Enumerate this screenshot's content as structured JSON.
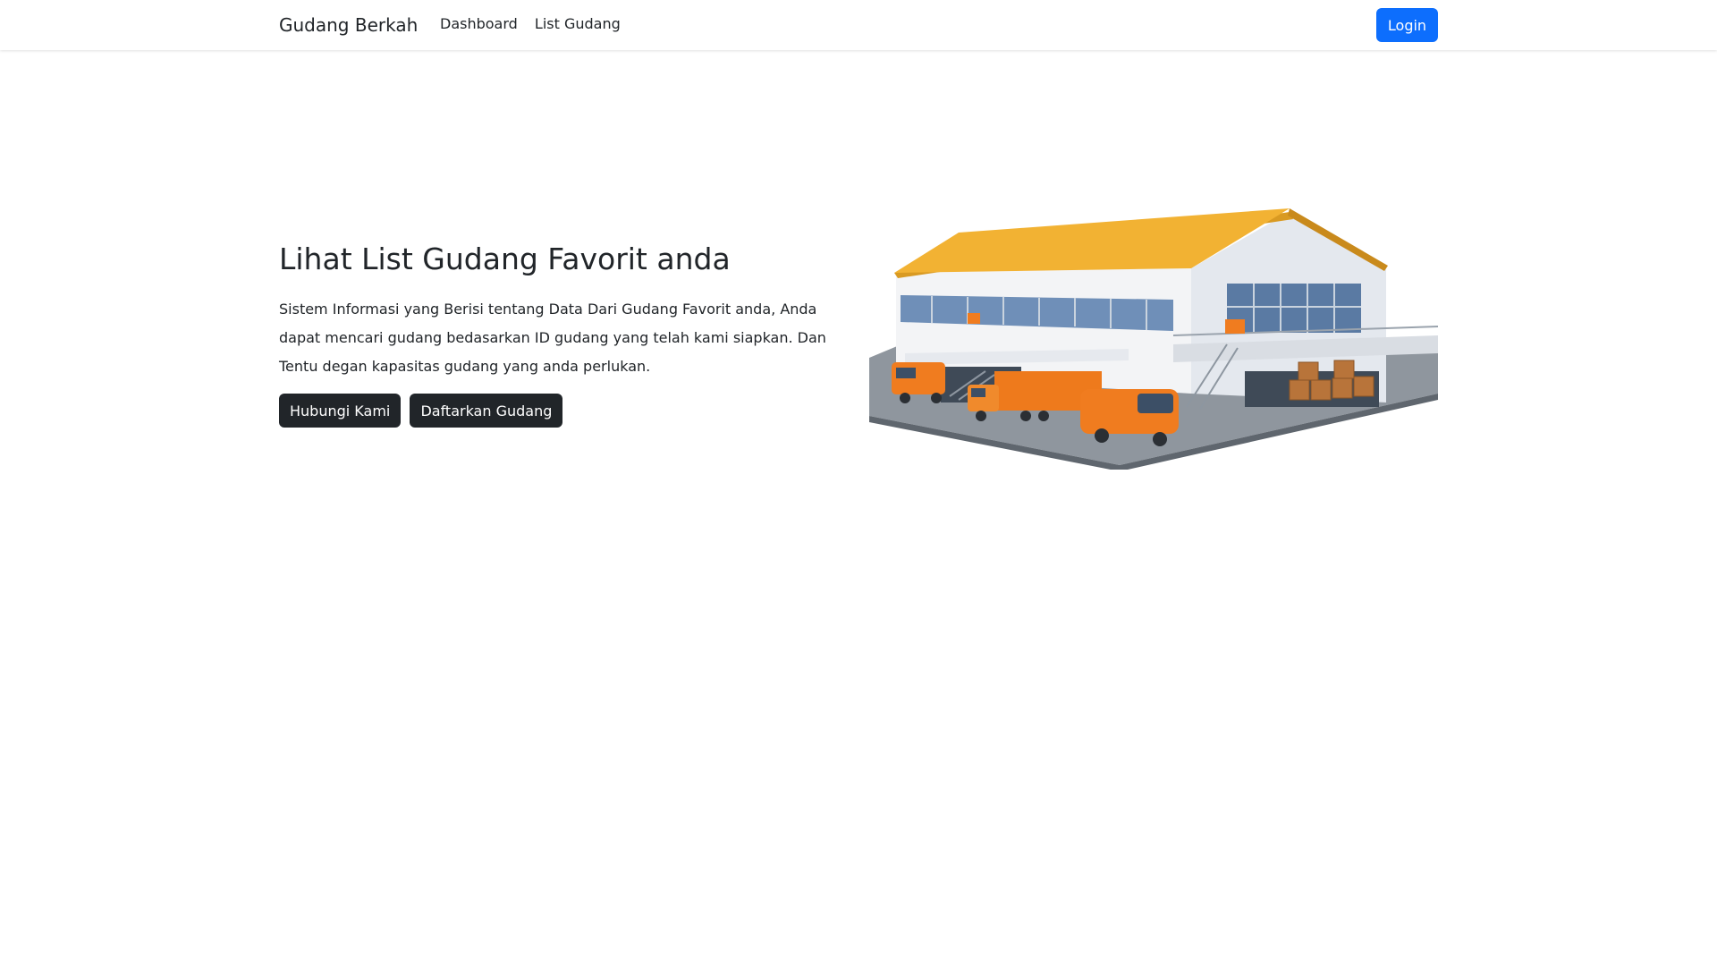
{
  "navbar": {
    "brand": "Gudang Berkah",
    "links": [
      "Dashboard",
      "List Gudang"
    ],
    "login_label": "Login"
  },
  "hero": {
    "title": "Lihat List Gudang Favorit anda",
    "description": "Sistem Informasi yang Berisi tentang Data Dari Gudang Favorit anda, Anda dapat mencari gudang bedasarkan ID gudang yang telah kami siapkan. Dan Tentu degan kapasitas gudang yang anda perlukan.",
    "buttons": [
      "Hubungi Kami",
      "Daftarkan Gudang"
    ]
  },
  "colors": {
    "primary": "#0d6efd",
    "dark": "#212529",
    "roof": "#f2b233",
    "truck": "#f07c1f"
  },
  "icons": {
    "illustration": "warehouse-illustration"
  }
}
